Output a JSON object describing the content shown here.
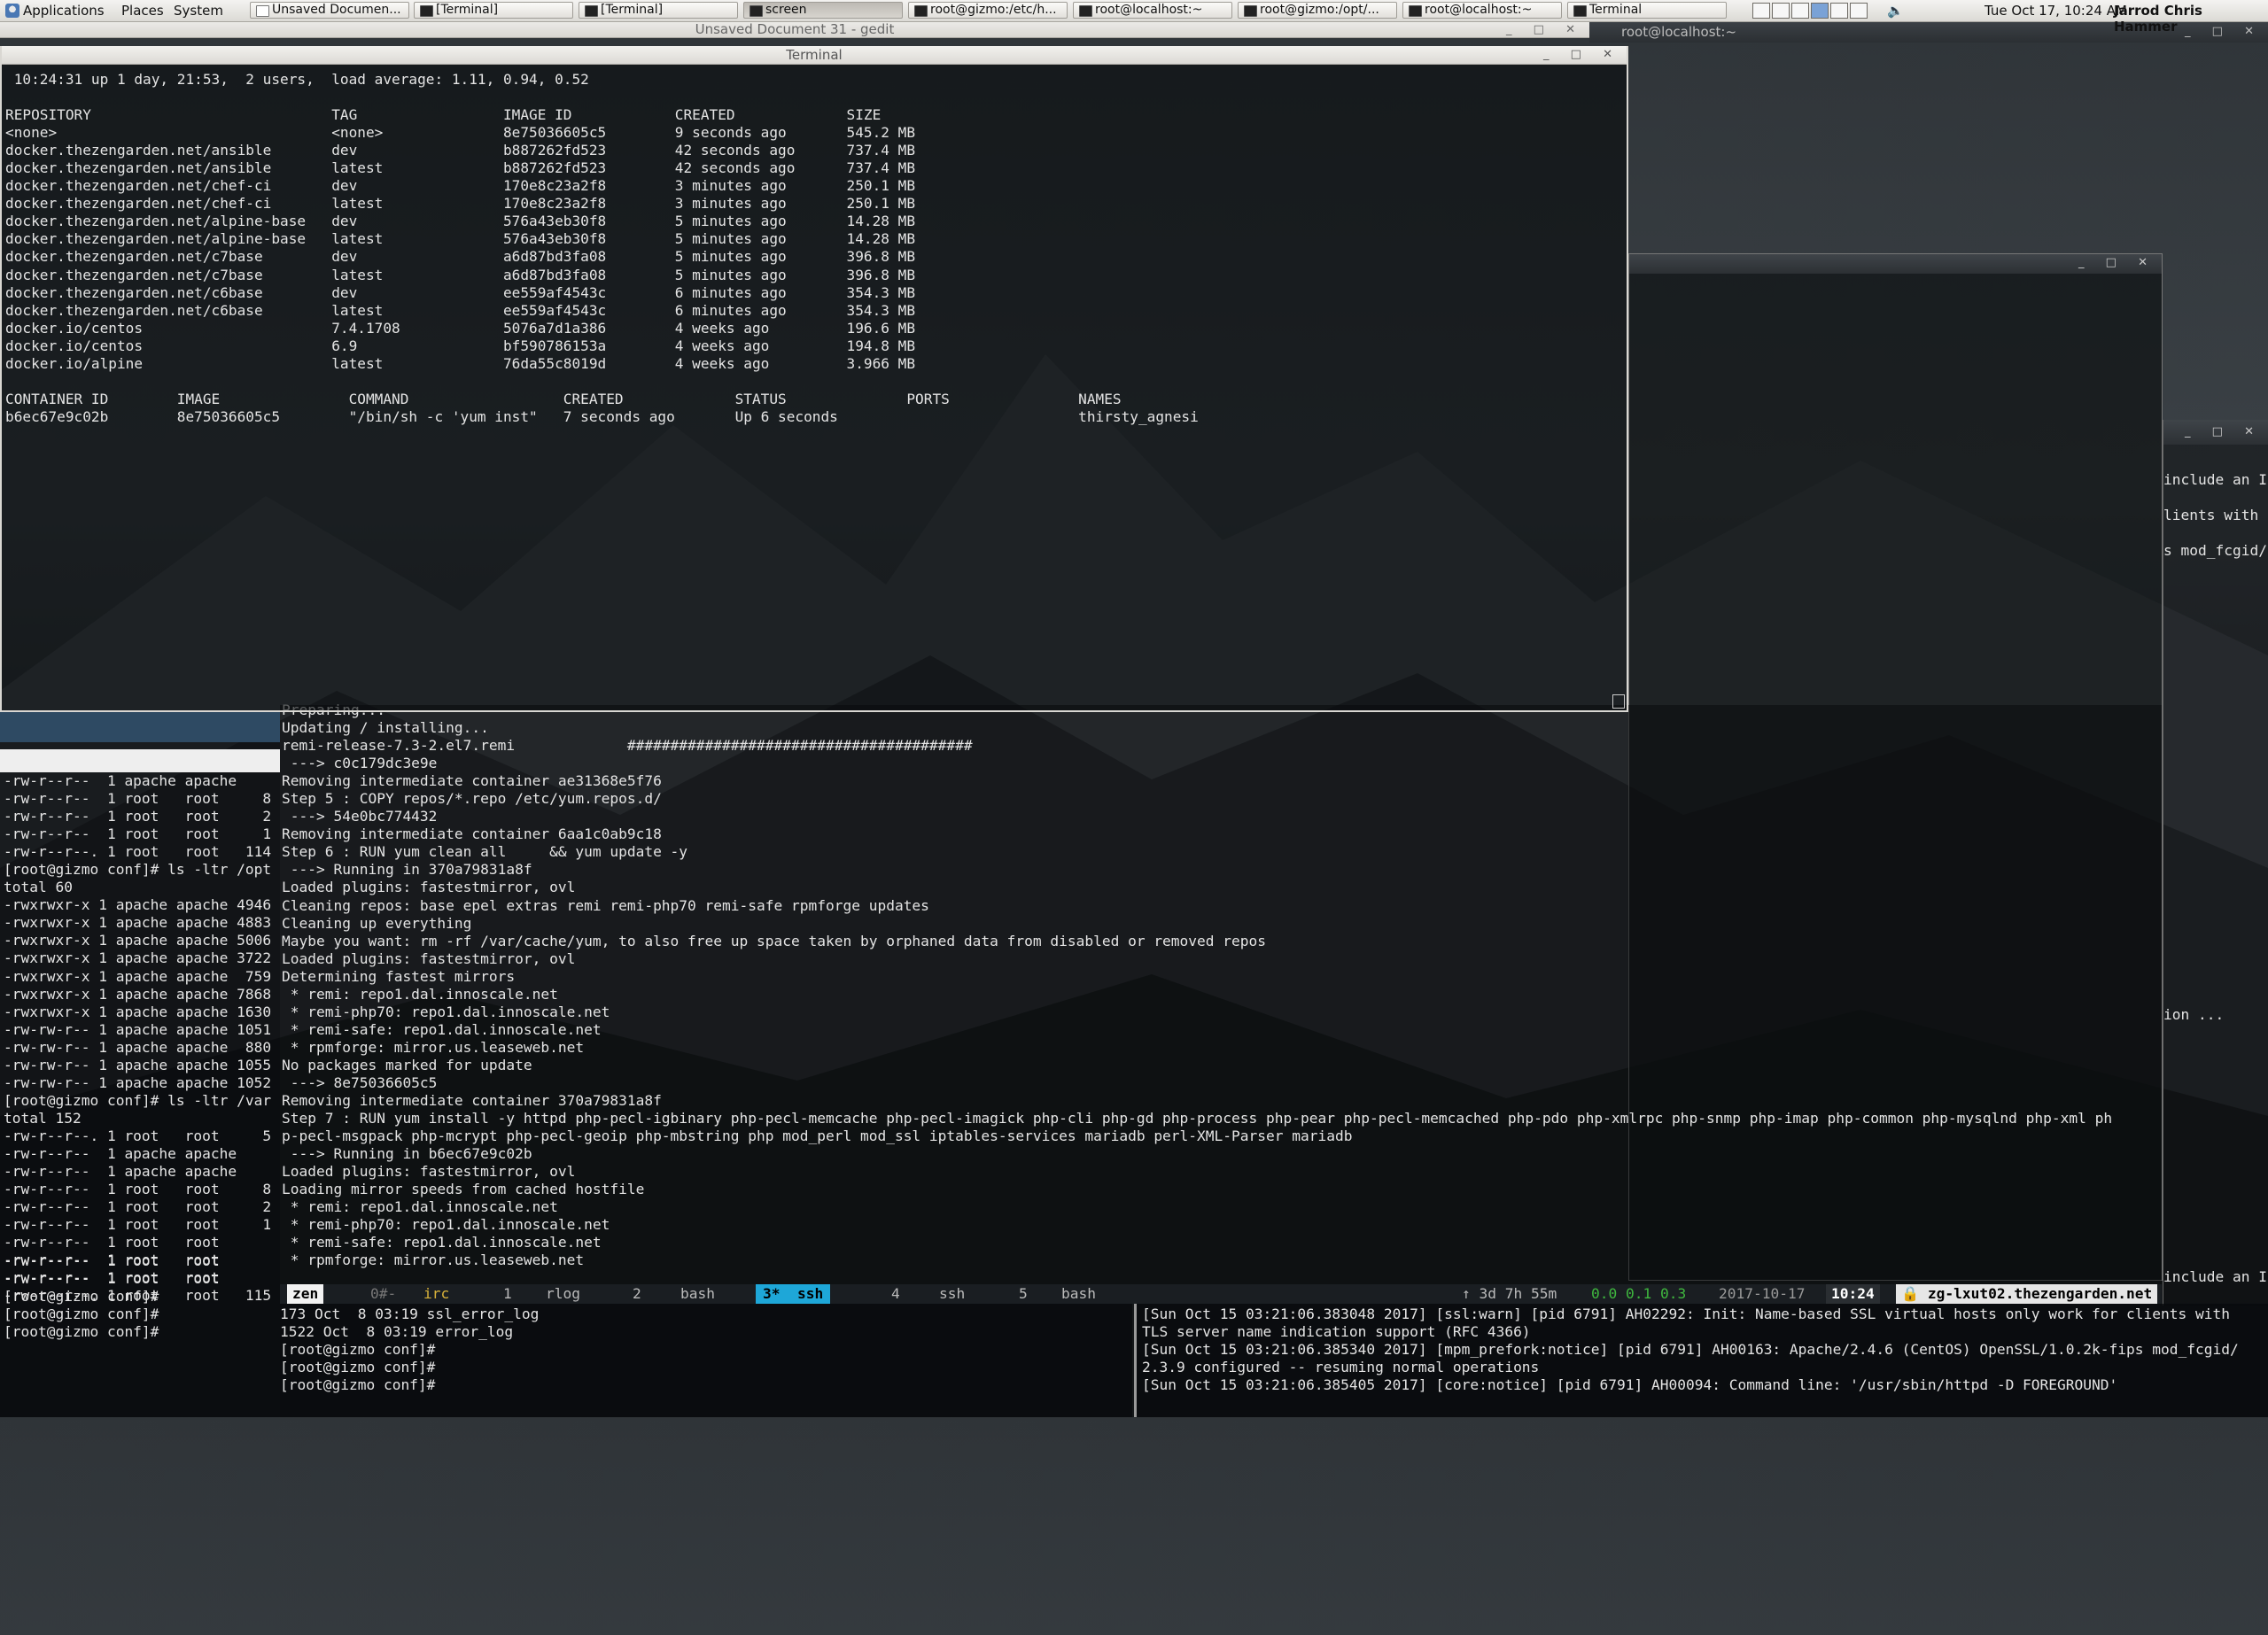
{
  "panel": {
    "menus": [
      "Applications",
      "Places",
      "System"
    ],
    "tasks": [
      "Unsaved Documen...",
      "[Terminal]",
      "[Terminal]",
      "screen",
      "root@gizmo:/etc/h...",
      "root@localhost:~",
      "root@gizmo:/opt/...",
      "root@localhost:~",
      "Terminal"
    ],
    "clock": "Tue Oct 17, 10:24 AM",
    "user": "Jarrod Chris Hammer"
  },
  "windows": {
    "gedit_title": "Unsaved Document 31 - gedit",
    "root_localhost_title": "root@localhost:~",
    "main_terminal_title": "Terminal"
  },
  "main_terminal": {
    "uptime": "10:24:31 up 1 day, 21:53,  2 users,  load average: 1.11, 0.94, 0.52",
    "images": {
      "headers": [
        "REPOSITORY",
        "TAG",
        "IMAGE ID",
        "CREATED",
        "SIZE"
      ],
      "rows": [
        [
          "<none>",
          "<none>",
          "8e75036605c5",
          "9 seconds ago",
          "545.2 MB"
        ],
        [
          "docker.thezengarden.net/ansible",
          "dev",
          "b887262fd523",
          "42 seconds ago",
          "737.4 MB"
        ],
        [
          "docker.thezengarden.net/ansible",
          "latest",
          "b887262fd523",
          "42 seconds ago",
          "737.4 MB"
        ],
        [
          "docker.thezengarden.net/chef-ci",
          "dev",
          "170e8c23a2f8",
          "3 minutes ago",
          "250.1 MB"
        ],
        [
          "docker.thezengarden.net/chef-ci",
          "latest",
          "170e8c23a2f8",
          "3 minutes ago",
          "250.1 MB"
        ],
        [
          "docker.thezengarden.net/alpine-base",
          "dev",
          "576a43eb30f8",
          "5 minutes ago",
          "14.28 MB"
        ],
        [
          "docker.thezengarden.net/alpine-base",
          "latest",
          "576a43eb30f8",
          "5 minutes ago",
          "14.28 MB"
        ],
        [
          "docker.thezengarden.net/c7base",
          "dev",
          "a6d87bd3fa08",
          "5 minutes ago",
          "396.8 MB"
        ],
        [
          "docker.thezengarden.net/c7base",
          "latest",
          "a6d87bd3fa08",
          "5 minutes ago",
          "396.8 MB"
        ],
        [
          "docker.thezengarden.net/c6base",
          "dev",
          "ee559af4543c",
          "6 minutes ago",
          "354.3 MB"
        ],
        [
          "docker.thezengarden.net/c6base",
          "latest",
          "ee559af4543c",
          "6 minutes ago",
          "354.3 MB"
        ],
        [
          "docker.io/centos",
          "7.4.1708",
          "5076a7d1a386",
          "4 weeks ago",
          "196.6 MB"
        ],
        [
          "docker.io/centos",
          "6.9",
          "bf590786153a",
          "4 weeks ago",
          "194.8 MB"
        ],
        [
          "docker.io/alpine",
          "latest",
          "76da55c8019d",
          "4 weeks ago",
          "3.966 MB"
        ]
      ]
    },
    "containers": {
      "headers": [
        "CONTAINER ID",
        "IMAGE",
        "COMMAND",
        "CREATED",
        "STATUS",
        "PORTS",
        "NAMES"
      ],
      "rows": [
        [
          "b6ec67e9c02b",
          "8e75036605c5",
          "\"/bin/sh -c 'yum inst\"",
          "7 seconds ago",
          "Up 6 seconds",
          "",
          "thirsty_agnesi"
        ]
      ]
    }
  },
  "screen_terminal": {
    "lines": [
      "Preparing...",
      "Updating / installing...",
      "remi-release-7.3-2.el7.remi             ########################################",
      " ---> c0c179dc3e9e",
      "Removing intermediate container ae31368e5f76",
      "Step 5 : COPY repos/*.repo /etc/yum.repos.d/",
      " ---> 54e0bc774432",
      "Removing intermediate container 6aa1c0ab9c18",
      "Step 6 : RUN yum clean all     && yum update -y",
      " ---> Running in 370a79831a8f",
      "Loaded plugins: fastestmirror, ovl",
      "Cleaning repos: base epel extras remi remi-php70 remi-safe rpmforge updates",
      "Cleaning up everything",
      "Maybe you want: rm -rf /var/cache/yum, to also free up space taken by orphaned data from disabled or removed repos",
      "Loaded plugins: fastestmirror, ovl",
      "Determining fastest mirrors",
      " * remi: repo1.dal.innoscale.net",
      " * remi-php70: repo1.dal.innoscale.net",
      " * remi-safe: repo1.dal.innoscale.net",
      " * rpmforge: mirror.us.leaseweb.net",
      "No packages marked for update",
      " ---> 8e75036605c5",
      "Removing intermediate container 370a79831a8f",
      "Step 7 : RUN yum install -y httpd php-pecl-igbinary php-pecl-memcache php-pecl-imagick php-cli php-gd php-process php-pear php-pecl-memcached php-pdo php-xmlrpc php-snmp php-imap php-common php-mysqlnd php-xml ph",
      "p-pecl-msgpack php-mcrypt php-pecl-geoip php-mbstring php mod_perl mod_ssl iptables-services mariadb perl-XML-Parser mariadb",
      " ---> Running in b6ec67e9c02b",
      "Loaded plugins: fastestmirror, ovl",
      "Loading mirror speeds from cached hostfile",
      " * remi: repo1.dal.innoscale.net",
      " * remi-php70: repo1.dal.innoscale.net",
      " * remi-safe: repo1.dal.innoscale.net",
      " * rpmforge: mirror.us.leaseweb.net"
    ]
  },
  "status_bar": {
    "session": "zen",
    "windows": [
      {
        "num": "0#-",
        "name": "irc"
      },
      {
        "num": "1",
        "name": "rlog"
      },
      {
        "num": "2",
        "name": "bash"
      },
      {
        "num": "3*",
        "name": "ssh"
      },
      {
        "num": "4",
        "name": "ssh"
      },
      {
        "num": "5",
        "name": "bash"
      }
    ],
    "uptime": "↑ 3d 7h 55m",
    "load": "0.0 0.1 0.3",
    "date": "2017-10-17",
    "time": "10:24",
    "host": "zg-lxut02.thezengarden.net"
  },
  "left_terminal": {
    "lines": [
      "-rw-r--r--  1 apache apache",
      "-rw-r--r--  1 root   root     8",
      "-rw-r--r--  1 root   root     2",
      "-rw-r--r--  1 root   root     1",
      "-rw-r--r--. 1 root   root   114",
      "[root@gizmo conf]# ls -ltr /opt",
      "total 60",
      "-rwxrwxr-x 1 apache apache 4946",
      "-rwxrwxr-x 1 apache apache 4883",
      "-rwxrwxr-x 1 apache apache 5006",
      "-rwxrwxr-x 1 apache apache 3722",
      "-rwxrwxr-x 1 apache apache  759",
      "-rwxrwxr-x 1 apache apache 7868",
      "-rwxrwxr-x 1 apache apache 1630",
      "-rw-rw-r-- 1 apache apache 1051",
      "-rw-rw-r-- 1 apache apache  880",
      "-rw-rw-r-- 1 apache apache 1055",
      "-rw-rw-r-- 1 apache apache 1052",
      "[root@gizmo conf]# ls -ltr /var",
      "total 152",
      "-rw-r--r--. 1 root   root     5",
      "-rw-r--r--  1 apache apache",
      "-rw-r--r--  1 apache apache",
      "-rw-r--r--  1 root   root     8",
      "-rw-r--r--  1 root   root     2",
      "-rw-r--r--  1 root   root     1",
      "-rw-r--r--  1 root   root",
      "-rw-r--r--  1 root   root",
      "-rw-r--r--  1 root   root",
      "-rw-r--r--. 1 root   root   115"
    ]
  },
  "bottom_middle": {
    "lines": [
      "173 Oct  8 03:19 ssl_error_log",
      "1522 Oct  8 03:19 error_log",
      "[root@gizmo conf]#",
      "[root@gizmo conf]#",
      "[root@gizmo conf]#"
    ]
  },
  "bottom_left_tail": {
    "lines": [
      "-rw-r--r--  1 root   root",
      "-rw-r--r--  1 root   root",
      "[root@gizmo conf]#",
      "[root@gizmo conf]#",
      "[root@gizmo conf]# "
    ]
  },
  "bottom_right": {
    "lines": [
      "[Sun Oct 15 03:21:06.383048 2017] [ssl:warn] [pid 6791] AH02292: Init: Name-based SSL virtual hosts only work for clients with",
      "TLS server name indication support (RFC 4366)",
      "[Sun Oct 15 03:21:06.385340 2017] [mpm_prefork:notice] [pid 6791] AH00163: Apache/2.4.6 (CentOS) OpenSSL/1.0.2k-fips mod_fcgid/",
      "2.3.9 configured -- resuming normal operations",
      "[Sun Oct 15 03:21:06.385405 2017] [core:notice] [pid 6791] AH00094: Command line: '/usr/sbin/httpd -D FOREGROUND'"
    ]
  },
  "far_right": {
    "lines": [
      "include an I",
      "",
      "lients with",
      "",
      "s mod_fcgid/"
    ],
    "mid_line": "ion ...",
    "bottom_line": "include an I"
  },
  "colors": {
    "accent_ssh": "#1ea7d8",
    "load_green": "#3fb83f"
  }
}
